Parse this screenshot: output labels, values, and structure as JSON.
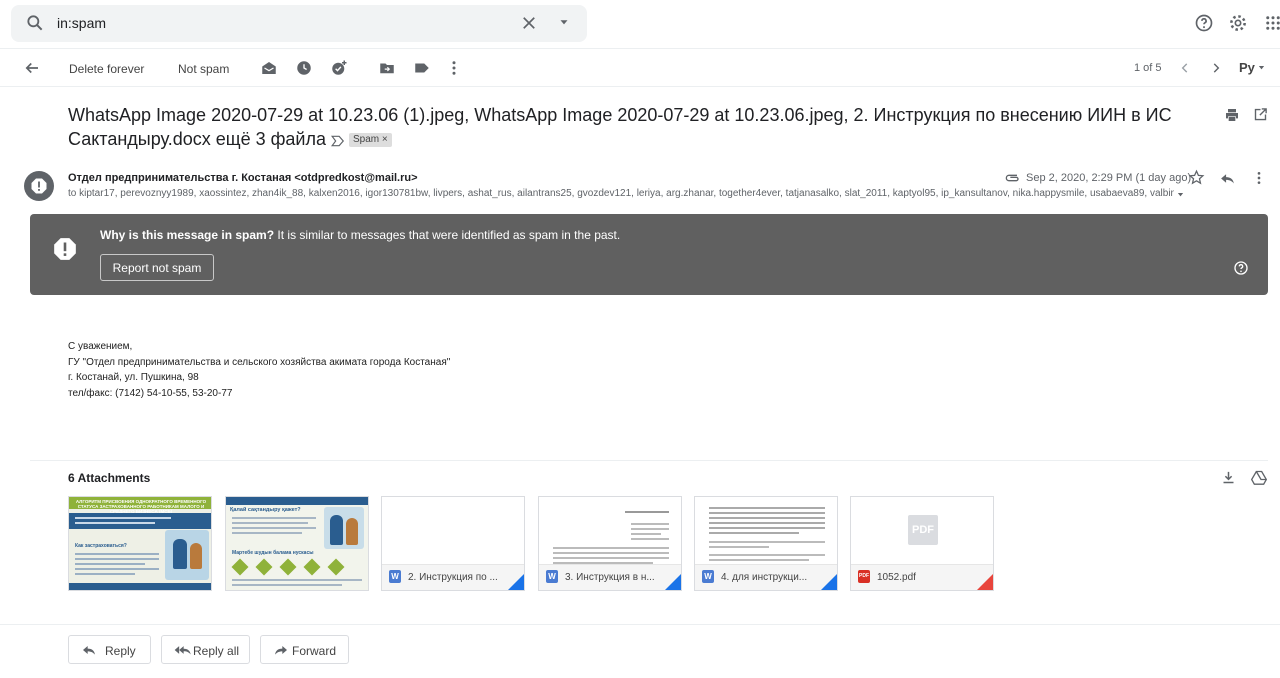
{
  "search": {
    "query": "in:spam"
  },
  "toolbar": {
    "delete_forever": "Delete forever",
    "not_spam": "Not spam",
    "pager": "1 of 5",
    "lang": "Ру"
  },
  "message": {
    "subject": "WhatsApp Image 2020-07-29 at 10.23.06 (1).jpeg, WhatsApp Image 2020-07-29 at 10.23.06.jpeg, 2. Инструкция по внесению ИИН в ИС Сактандыру.docx ещё 3 файла",
    "label": "Spam",
    "sender": "Отдел предпринимательства г. Костаная <otdpredkost@mail.ru>",
    "to": "to kiptar17, perevoznyy1989, xaossintez, zhan4ik_88, kalxen2016, igor130781bw, livpers, ashat_rus, ailantrans25, gvozdev121, leriya, arg.zhanar, together4ever, tatjanasalko, slat_2011, kaptyol95, ip_kansultanov, nika.happysmile, usabaeva89, valbin",
    "date": "Sep 2, 2020, 2:29 PM (1 day ago)"
  },
  "banner": {
    "question": "Why is this message in spam?",
    "explanation": " It is similar to messages that were identified as spam in the past.",
    "button": "Report not spam"
  },
  "signature": {
    "line1": "С уважением,",
    "line2": "ГУ \"Отдел предпринимательства и сельского хозяйства акимата города Костаная\"",
    "line3": "г. Костанай, ул. Пушкина, 98",
    "line4": "тел/факс: (7142) 54-10-55, 53-20-77"
  },
  "attachments": {
    "title": "6 Attachments",
    "items": [
      {
        "name": "",
        "kind": "image"
      },
      {
        "name": "",
        "kind": "image"
      },
      {
        "name": "2. Инструкция по ...",
        "kind": "docx"
      },
      {
        "name": "3. Инструкция в н...",
        "kind": "docx"
      },
      {
        "name": "4. для инструкци...",
        "kind": "docx"
      },
      {
        "name": "1052.pdf",
        "kind": "pdf"
      }
    ],
    "pdf_placeholder": "PDF",
    "img1": {
      "heading": "АЛГОРИТМ ПРИСВОЕНИЯ ОДНОКРАТНОГО ВРЕМЕННОГО СТАТУСА ЗАСТРАХОВАННОГО РАБОТНИКАМ МАЛОГО И СРЕДНЕГО БИЗНЕСА (МСБ)",
      "sub": "Как застраховаться?"
    },
    "img2": {
      "heading": "Қалай сақтандыру қажет?",
      "sub": "Мартебе шудын балама нускасы"
    }
  },
  "reply": {
    "reply": "Reply",
    "reply_all": "Reply all",
    "forward": "Forward"
  },
  "colors": {
    "banner": "#606060",
    "accent": "#1a73e8",
    "pdf": "#e8453c"
  }
}
